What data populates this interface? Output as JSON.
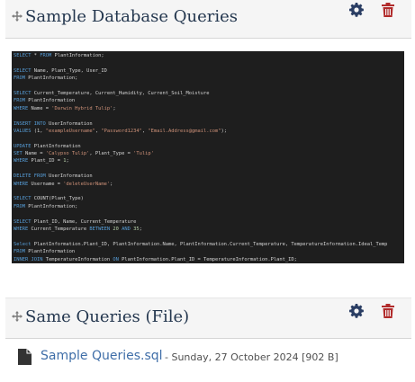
{
  "block1": {
    "title": "Sample Database Queries"
  },
  "block2": {
    "title": "Same Queries (File)"
  },
  "code_lines": [
    [
      {
        "t": "SELECT",
        "c": "kw"
      },
      {
        "t": " * "
      },
      {
        "t": "FROM",
        "c": "kw"
      },
      {
        "t": " PlantInformation;"
      }
    ],
    [],
    [
      {
        "t": "SELECT",
        "c": "kw"
      },
      {
        "t": " Name, Plant_Type, User_ID"
      }
    ],
    [
      {
        "t": "FROM",
        "c": "kw"
      },
      {
        "t": " PlantInformation;"
      }
    ],
    [],
    [
      {
        "t": "SELECT",
        "c": "kw"
      },
      {
        "t": " Current_Temperature, Current_Humidity, Current_Soil_Moisture"
      }
    ],
    [
      {
        "t": "FROM",
        "c": "kw"
      },
      {
        "t": " PlantInformation"
      }
    ],
    [
      {
        "t": "WHERE",
        "c": "kw"
      },
      {
        "t": " Name = "
      },
      {
        "t": "'Darwin Hybrid Tulip'",
        "c": "st"
      },
      {
        "t": ";"
      }
    ],
    [],
    [
      {
        "t": "INSERT INTO",
        "c": "kw"
      },
      {
        "t": " UserInformation"
      }
    ],
    [
      {
        "t": "VALUES",
        "c": "kw"
      },
      {
        "t": " (1, "
      },
      {
        "t": "\"exampleUsername\"",
        "c": "st"
      },
      {
        "t": ", "
      },
      {
        "t": "\"Password1234\"",
        "c": "st"
      },
      {
        "t": ", "
      },
      {
        "t": "\"Email.Address@gmail.com\"",
        "c": "st"
      },
      {
        "t": ");"
      }
    ],
    [],
    [
      {
        "t": "UPDATE",
        "c": "kw"
      },
      {
        "t": " PlantInformation"
      }
    ],
    [
      {
        "t": "SET",
        "c": "kw"
      },
      {
        "t": " Name = "
      },
      {
        "t": "'Calypso Tulip'",
        "c": "st"
      },
      {
        "t": ", Plant_Type = "
      },
      {
        "t": "'Tulip'",
        "c": "st"
      }
    ],
    [
      {
        "t": "WHERE",
        "c": "kw"
      },
      {
        "t": " Plant_ID = "
      },
      {
        "t": "1",
        "c": "nm"
      },
      {
        "t": ";"
      }
    ],
    [],
    [
      {
        "t": "DELETE FROM",
        "c": "kw"
      },
      {
        "t": " UserInformation"
      }
    ],
    [
      {
        "t": "WHERE",
        "c": "kw"
      },
      {
        "t": " Username = "
      },
      {
        "t": "'deleteUserName'",
        "c": "st"
      },
      {
        "t": ";"
      }
    ],
    [],
    [
      {
        "t": "SELECT",
        "c": "kw"
      },
      {
        "t": " COUNT(Plant_Type)"
      }
    ],
    [
      {
        "t": "FROM",
        "c": "kw"
      },
      {
        "t": " PlantInformation;"
      }
    ],
    [],
    [
      {
        "t": "SELECT",
        "c": "kw"
      },
      {
        "t": " Plant_ID, Name, Current_Temperature"
      }
    ],
    [
      {
        "t": "WHERE",
        "c": "kw"
      },
      {
        "t": " Current_Temperature "
      },
      {
        "t": "BETWEEN",
        "c": "kw"
      },
      {
        "t": " "
      },
      {
        "t": "20",
        "c": "nm"
      },
      {
        "t": " "
      },
      {
        "t": "AND",
        "c": "kw"
      },
      {
        "t": " "
      },
      {
        "t": "35",
        "c": "nm"
      },
      {
        "t": ";"
      }
    ],
    [],
    [
      {
        "t": "Select",
        "c": "kw"
      },
      {
        "t": " PlantInformation.Plant_ID, PlantInformation.Name, PlantInformation.Current_Temperature, TemperatureInformation.Ideal_Temp"
      }
    ],
    [
      {
        "t": "FROM",
        "c": "kw"
      },
      {
        "t": " PlantInformation"
      }
    ],
    [
      {
        "t": "INNER JOIN",
        "c": "kw"
      },
      {
        "t": " TemperatureInformation "
      },
      {
        "t": "ON",
        "c": "kw"
      },
      {
        "t": " PlantInformation.Plant_ID = TemperatureInformation.Plant_ID;"
      }
    ]
  ],
  "file": {
    "name": "Sample Queries.sql",
    "meta": "- Sunday, 27 October 2024 [902 B]"
  },
  "colors": {
    "title": "#23364e",
    "gear": "#2a3d63",
    "trash": "#b12a2a",
    "link": "#3f6ea8",
    "code_bg": "#1e1e1e"
  },
  "icons": [
    "move-icon",
    "gear-icon",
    "trash-icon",
    "file-icon"
  ]
}
